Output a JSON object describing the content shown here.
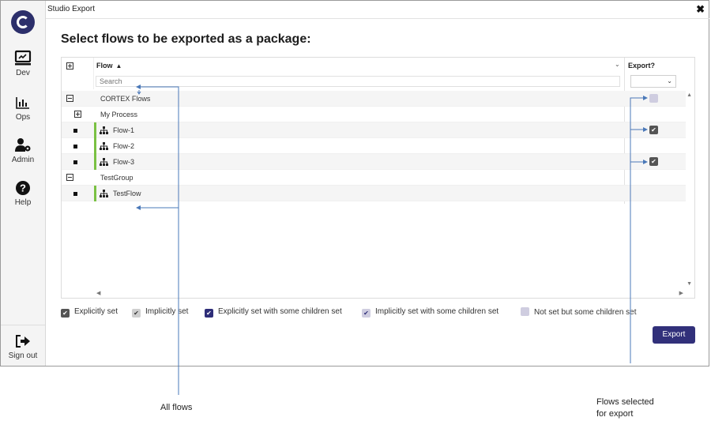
{
  "window": {
    "title": "Studio Export",
    "close_glyph": "✖"
  },
  "sidebar": {
    "logo_icon": "cortex-logo-icon",
    "items": [
      {
        "label": "Dev",
        "icon": "monitor-icon"
      },
      {
        "label": "Ops",
        "icon": "bar-chart-icon"
      },
      {
        "label": "Admin",
        "icon": "user-gear-icon"
      },
      {
        "label": "Help",
        "icon": "question-icon"
      }
    ],
    "signout": {
      "label": "Sign out",
      "icon": "sign-out-icon"
    }
  },
  "page": {
    "heading": "Select flows to be exported as a package:"
  },
  "grid": {
    "col_flow": "Flow",
    "sort_glyph": "▲",
    "chevron_glyph": "⌄",
    "col_export": "Export?",
    "search_placeholder": "Search",
    "select_chevron": "⌄",
    "rows": [
      {
        "label": "CORTEX Flows"
      },
      {
        "label": "My Process"
      },
      {
        "label": "Flow-1"
      },
      {
        "label": "Flow-2"
      },
      {
        "label": "Flow-3"
      },
      {
        "label": "TestGroup"
      },
      {
        "label": "TestFlow"
      }
    ],
    "check_glyph": "✔"
  },
  "legend": [
    {
      "label": "Explicitly set",
      "color": "#555555"
    },
    {
      "label": "Implicitly set",
      "color": "#cfcfcf"
    },
    {
      "label": "Explicitly set with some children set",
      "color": "#2e2d78"
    },
    {
      "label": "Implicitly set with some children set",
      "color": "#cfcde0"
    },
    {
      "label": "Not set but some children set",
      "color": "#cfcde0"
    }
  ],
  "buttons": {
    "export": "Export"
  },
  "annotations": {
    "all_flows": "All flows",
    "selected_line1": "Flows selected",
    "selected_line2": "for export"
  },
  "colors": {
    "accent": "#31307a",
    "flow_marker": "#7ac143",
    "annotation_line": "#4a78b8"
  }
}
